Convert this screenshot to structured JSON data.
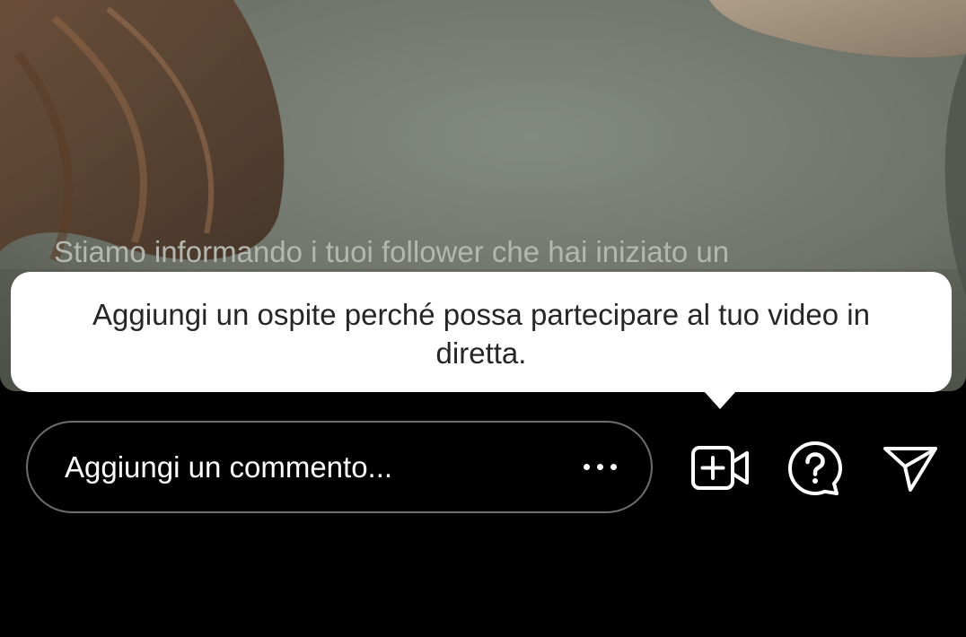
{
  "live": {
    "status_text": "Stiamo informando i tuoi follower che hai iniziato un"
  },
  "tooltip": {
    "text": "Aggiungi un ospite perché possa partecipare al tuo video in diretta."
  },
  "comment": {
    "placeholder": "Aggiungi un commento..."
  },
  "icons": {
    "more": "more-dots-icon",
    "add_guest": "add-guest-video-icon",
    "questions": "question-bubble-icon",
    "share": "send-paper-plane-icon"
  },
  "colors": {
    "background": "#000000",
    "tooltip_bg": "#ffffff",
    "tooltip_text": "#262626",
    "comment_border": "#6e6e6e"
  }
}
